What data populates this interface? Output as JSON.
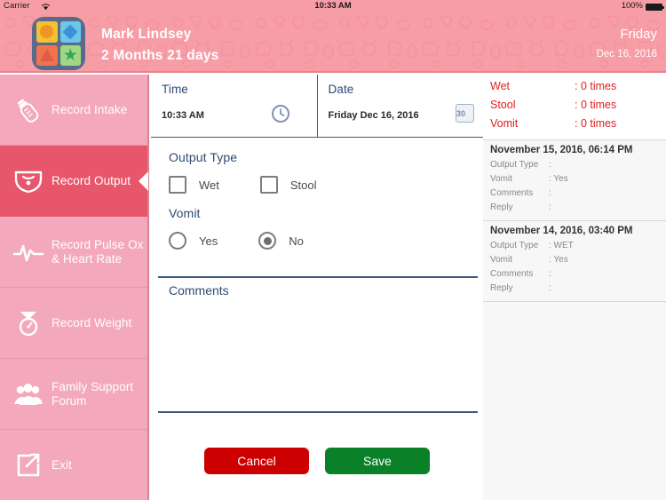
{
  "statusbar": {
    "carrier": "Carrier",
    "wifi_icon": "wifi-icon",
    "time": "10:33 AM",
    "battery_pct": "100%",
    "battery_icon": "battery-full-icon"
  },
  "header": {
    "logo_icon": "app-logo-icon",
    "baby_name": "Mark Lindsey",
    "baby_age": "2 Months 21 days",
    "day_of_week": "Friday",
    "date": "Dec 16, 2016",
    "background_color": "#f79da5"
  },
  "sidebar": {
    "active_color": "#e8566b",
    "base_color": "#f4a8bb",
    "items": [
      {
        "label": "Record Intake",
        "icon": "baby-bottle-icon",
        "active": false
      },
      {
        "label": "Record Output",
        "icon": "diaper-icon",
        "active": true
      },
      {
        "label": "Record Pulse Ox & Heart Rate",
        "icon": "heart-rate-icon",
        "active": false
      },
      {
        "label": "Record Weight",
        "icon": "weight-scale-icon",
        "active": false
      },
      {
        "label": "Family Support Forum",
        "icon": "people-group-icon",
        "active": false
      },
      {
        "label": "Exit",
        "icon": "exit-icon",
        "active": false
      }
    ]
  },
  "form": {
    "time": {
      "label": "Time",
      "value": "10:33 AM",
      "icon": "clock-icon"
    },
    "date": {
      "label": "Date",
      "value": "Friday Dec 16, 2016",
      "icon": "calendar-icon",
      "icon_day": "30"
    },
    "output_type": {
      "label": "Output Type",
      "options": [
        {
          "label": "Wet",
          "checked": false
        },
        {
          "label": "Stool",
          "checked": false
        }
      ]
    },
    "vomit": {
      "label": "Vomit",
      "options": [
        {
          "label": "Yes",
          "checked": false
        },
        {
          "label": "No",
          "checked": true
        }
      ]
    },
    "comments": {
      "label": "Comments",
      "value": "",
      "placeholder": ""
    },
    "cancel_label": "Cancel",
    "save_label": "Save",
    "cancel_color": "#cc0000",
    "save_color": "#0a8028"
  },
  "history": {
    "summary_color": "#e02020",
    "summary": [
      {
        "key": "Wet",
        "value": ": 0 times"
      },
      {
        "key": "Stool",
        "value": ": 0 times"
      },
      {
        "key": "Vomit",
        "value": ": 0 times"
      }
    ],
    "entries": [
      {
        "date": "November 15, 2016, 06:14 PM",
        "fields": [
          {
            "key": "Output Type",
            "value": ":"
          },
          {
            "key": "Vomit",
            "value": ": Yes"
          },
          {
            "key": "Comments",
            "value": ":"
          },
          {
            "key": "Reply",
            "value": ":"
          }
        ]
      },
      {
        "date": "November 14, 2016, 03:40 PM",
        "fields": [
          {
            "key": "Output Type",
            "value": ": WET"
          },
          {
            "key": "Vomit",
            "value": ": Yes"
          },
          {
            "key": "Comments",
            "value": ":"
          },
          {
            "key": "Reply",
            "value": ":"
          }
        ]
      }
    ]
  }
}
